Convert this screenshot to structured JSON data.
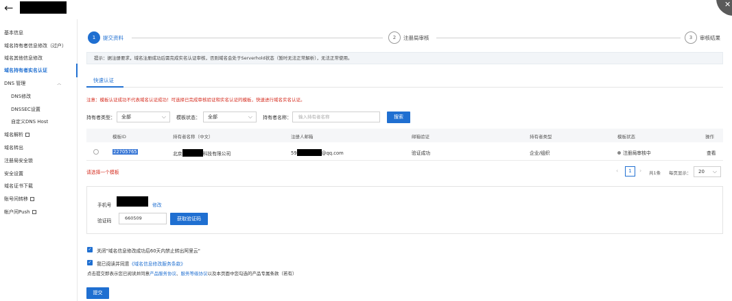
{
  "header": {
    "back_icon": "arrow-left-icon"
  },
  "sidebar": {
    "items": [
      {
        "label": "基本信息",
        "type": "item"
      },
      {
        "label": "域名持有者信息修改（过户）",
        "type": "item"
      },
      {
        "label": "域名其他信息修改",
        "type": "item"
      },
      {
        "label": "域名持有者实名认证",
        "type": "item",
        "active": true
      },
      {
        "label": "DNS 管理",
        "type": "group"
      },
      {
        "label": "DNS修改",
        "type": "sub"
      },
      {
        "label": "DNSSEC设置",
        "type": "sub"
      },
      {
        "label": "自定义DNS Host",
        "type": "sub"
      },
      {
        "label": "域名解析",
        "type": "item",
        "external": true
      },
      {
        "label": "域名转出",
        "type": "item"
      },
      {
        "label": "注册局安全锁",
        "type": "item"
      },
      {
        "label": "安全设置",
        "type": "item"
      },
      {
        "label": "域名证书下载",
        "type": "item"
      },
      {
        "label": "账号间转移",
        "type": "item",
        "external": true
      },
      {
        "label": "帐户间Push",
        "type": "item",
        "external": true
      }
    ]
  },
  "steps": [
    {
      "num": "1",
      "label": "提交资料",
      "current": true
    },
    {
      "num": "2",
      "label": "注册局审核",
      "current": false
    },
    {
      "num": "3",
      "label": "审核结果",
      "current": false
    }
  ],
  "tip": "提示：据注册要求，域名注册成功后需完成实名认证审核，否则域名会处于Serverhold状态（暂时无法正常解析），无法正常使用。",
  "tab": "快速认证",
  "notice": "注意：模板认证成功不代表域名认证成功！可选择已完成审核验证和实名认证的模板，快速进行域名实名认证。",
  "filters": {
    "holder_type_label": "持有者类型：",
    "holder_type_value": "全部",
    "template_status_label": "模板状态：",
    "template_status_value": "全部",
    "holder_name_label": "持有者名称：",
    "holder_name_placeholder": "输入持有者名称",
    "search_button": "搜索"
  },
  "table": {
    "headers": [
      "模板ID",
      "持有者名称（中文）",
      "注册人邮箱",
      "邮箱验证",
      "持有者类型",
      "模板状态",
      "操作"
    ],
    "rows": [
      {
        "id": "22705765",
        "name_prefix": "北京",
        "name_suffix": "科技有限公司",
        "email_prefix": "59",
        "email_suffix": "@qq.com",
        "email_verify": "验证成功",
        "holder_type": "企业/组织",
        "status": "注册局审核中",
        "action": "查看"
      }
    ]
  },
  "select_warning": "请选择一个模板",
  "pagination": {
    "current": "1",
    "total_text": "共1条",
    "per_page_label": "每页显示：",
    "per_page": "20"
  },
  "verify": {
    "phone_label": "手机号",
    "modify_link": "修改",
    "code_label": "验证码",
    "code_value": "660509",
    "get_code_button": "获取验证码"
  },
  "agreements": {
    "check1": "关闭\"域名信息修改成功后60天内禁止转出阿里云\"",
    "check2_prefix": "我已阅读并同意",
    "check2_link": "《域名信息修改服务条款》",
    "statement_prefix": "点击提交即表示您已阅读并同意",
    "statement_link1": "产品服务协议",
    "statement_sep": "、",
    "statement_link2": "服务等级协议",
    "statement_suffix": "以及本页面中您勾选的产品专属条款（若有）"
  },
  "submit_button": "提交"
}
